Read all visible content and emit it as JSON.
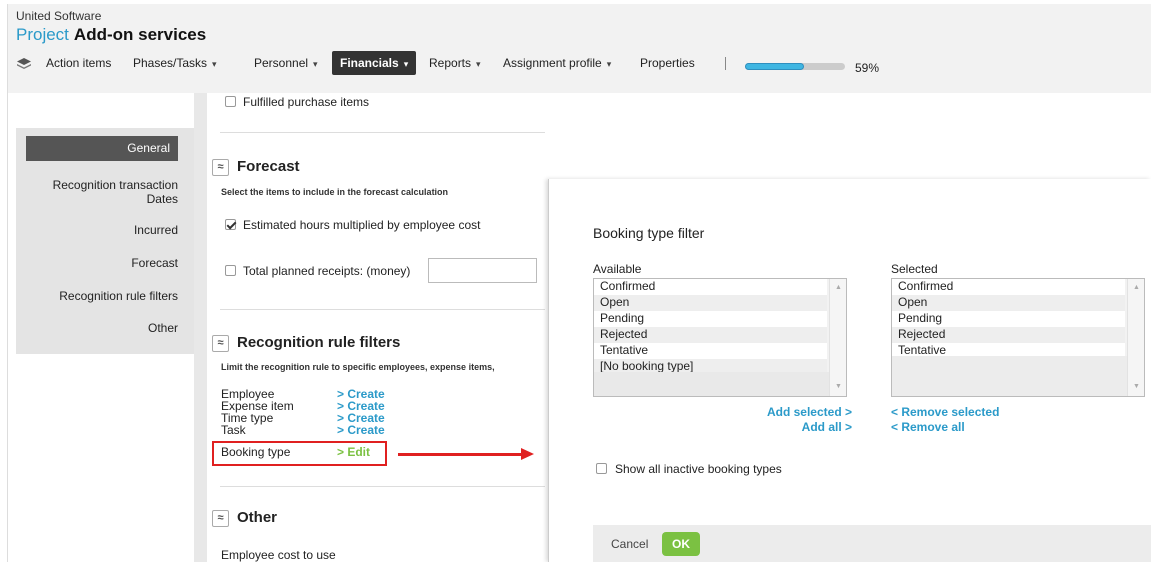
{
  "header": {
    "company": "United Software",
    "project_word": "Project",
    "project_name": "Add-on services"
  },
  "nav": {
    "icon": "layers-icon",
    "items": [
      "Action items",
      "Phases/Tasks",
      "Personnel",
      "Financials",
      "Reports",
      "Assignment profile",
      "Properties"
    ],
    "active": "Financials",
    "progress_percent": 59,
    "progress_label": "59%"
  },
  "sidebar": {
    "items": [
      "General",
      "Recognition transaction Dates",
      "Incurred",
      "Forecast",
      "Recognition rule filters",
      "Other"
    ],
    "active": "General"
  },
  "main": {
    "fulfilled_label": "Fulfilled purchase items",
    "forecast": {
      "title": "Forecast",
      "description": "Select the items to include in the forecast calculation",
      "estimated_label": "Estimated hours multiplied by employee cost",
      "estimated_checked": true,
      "planned_label": "Total planned receipts: (money)",
      "planned_checked": false
    },
    "filters": {
      "title": "Recognition rule filters",
      "description": "Limit the recognition rule to specific employees, expense items,",
      "rows": [
        {
          "label": "Employee",
          "action": "> Create"
        },
        {
          "label": "Expense item",
          "action": "> Create"
        },
        {
          "label": "Time type",
          "action": "> Create"
        },
        {
          "label": "Task",
          "action": "> Create"
        },
        {
          "label": "Booking type",
          "action": "> Edit"
        }
      ]
    },
    "other": {
      "title": "Other",
      "employee_cost_label": "Employee cost to use"
    }
  },
  "dialog": {
    "title": "Booking type filter",
    "available_label": "Available",
    "selected_label": "Selected",
    "available_items": [
      "Confirmed",
      "Open",
      "Pending",
      "Rejected",
      "Tentative",
      "[No booking type]"
    ],
    "selected_items": [
      "Confirmed",
      "Open",
      "Pending",
      "Rejected",
      "Tentative"
    ],
    "add_selected": "Add selected >",
    "add_all": "Add all >",
    "remove_selected": "< Remove selected",
    "remove_all": "< Remove all",
    "show_inactive_label": "Show all inactive booking types",
    "cancel_label": "Cancel",
    "ok_label": "OK"
  },
  "colors": {
    "accent": "#2b9ac9",
    "ok_green": "#7bc142",
    "highlight_red": "#e02020"
  }
}
